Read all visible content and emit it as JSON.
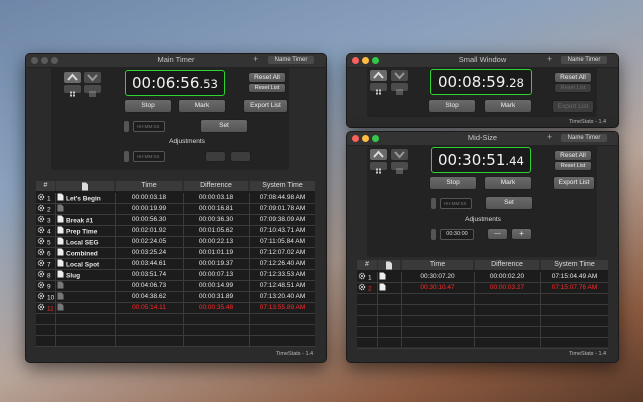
{
  "main": {
    "title": "Main Timer",
    "name_btn": "Name Timer",
    "timer_main": "00:06:56",
    "timer_frac": ".53",
    "reset_all": "Reset All",
    "reset_list": "Reset List",
    "stop": "Stop",
    "mark": "Mark",
    "export": "Export List",
    "set_placeholder": "HH:MM:SS",
    "set": "Set",
    "adjustments": "Adjustments",
    "adj_placeholder": "HH:MM:SS",
    "footer": "TimeStats - 1.4",
    "headers": [
      "#",
      "",
      "Time",
      "Difference",
      "System Time"
    ],
    "rows": [
      {
        "num": "1",
        "name": "Let's Begin",
        "time": "00:00:03.18",
        "diff": "00:00:03.18",
        "sys": "07:08:44.98 AM",
        "red": false,
        "doc": true
      },
      {
        "num": "2",
        "name": "",
        "time": "00:00:19.99",
        "diff": "00:00:16.81",
        "sys": "07:09:01.78 AM",
        "red": false,
        "doc": false
      },
      {
        "num": "3",
        "name": "Break #1",
        "time": "00:00:56.30",
        "diff": "00:00:36.30",
        "sys": "07:09:38.09 AM",
        "red": false,
        "doc": true
      },
      {
        "num": "4",
        "name": "Prep Time",
        "time": "00:02:01.92",
        "diff": "00:01:05.62",
        "sys": "07:10:43.71 AM",
        "red": false,
        "doc": true
      },
      {
        "num": "5",
        "name": "Local SEG",
        "time": "00:02:24.05",
        "diff": "00:00:22.13",
        "sys": "07:11:05.84 AM",
        "red": false,
        "doc": true
      },
      {
        "num": "6",
        "name": "Combined",
        "time": "00:03:25.24",
        "diff": "00:01:01.19",
        "sys": "07:12:07.02 AM",
        "red": false,
        "doc": true
      },
      {
        "num": "7",
        "name": "Local Spot",
        "time": "00:03:44.61",
        "diff": "00:00:19.37",
        "sys": "07:12:26.40 AM",
        "red": false,
        "doc": true
      },
      {
        "num": "8",
        "name": "Slug",
        "time": "00:03:51.74",
        "diff": "00:00:07.13",
        "sys": "07:12:33.53 AM",
        "red": false,
        "doc": true
      },
      {
        "num": "9",
        "name": "",
        "time": "00:04:06.73",
        "diff": "00:00:14.99",
        "sys": "07:12:48.51 AM",
        "red": false,
        "doc": false
      },
      {
        "num": "10",
        "name": "",
        "time": "00:04:38.62",
        "diff": "00:00:31.89",
        "sys": "07:13:20.40 AM",
        "red": false,
        "doc": false
      },
      {
        "num": "11",
        "name": "",
        "time": "00:05:14.11",
        "diff": "00:00:35.48",
        "sys": "07:13:55.89 AM",
        "red": true,
        "doc": false
      }
    ]
  },
  "small": {
    "title": "Small Window",
    "name_btn": "Name Timer",
    "timer_main": "00:08:59",
    "timer_frac": ".28",
    "reset_all": "Reset All",
    "reset_list": "Reset List",
    "stop": "Stop",
    "mark": "Mark",
    "export": "Export List",
    "footer": "TimeStats - 1.4"
  },
  "mid": {
    "title": "Mid-Size",
    "name_btn": "Name Timer",
    "timer_main": "00:30:51",
    "timer_frac": ".44",
    "reset_all": "Reset All",
    "reset_list": "Reset List",
    "stop": "Stop",
    "mark": "Mark",
    "export": "Export List",
    "set_placeholder": "HH:MM:SS",
    "set": "Set",
    "adjustments": "Adjustments",
    "adj_value": "00:30:00",
    "minus": "—",
    "plus": "+",
    "footer": "TimeStats - 1.4",
    "headers": [
      "#",
      "",
      "Time",
      "Difference",
      "System Time"
    ],
    "rows": [
      {
        "num": "1",
        "time": "00:30:07.20",
        "diff": "00:00:02.20",
        "sys": "07:15:04.49 AM",
        "red": false
      },
      {
        "num": "2",
        "time": "00:30:10.47",
        "diff": "00:00:03.27",
        "sys": "07:15:07.76 AM",
        "red": true
      }
    ]
  }
}
